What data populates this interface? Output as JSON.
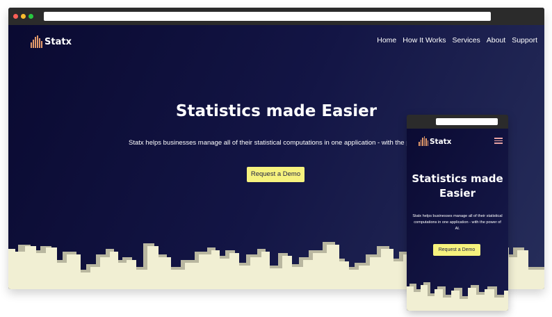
{
  "colors": {
    "accent": "#f6f27e",
    "logo_bars": "#e39a6b",
    "background_dark": "#0a0a31",
    "skyline": "#f1efd3",
    "skyline_shadow": "#b9b7a0"
  },
  "desktop": {
    "brand": "Statx",
    "nav": [
      "Home",
      "How It Works",
      "Services",
      "About",
      "Support"
    ],
    "hero_title": "Statistics made Easier",
    "hero_subtitle": "Statx helps businesses manage all of their statistical computations in one application - with the power",
    "cta_label": "Request a Demo"
  },
  "mobile": {
    "brand": "Statx",
    "menu_icon": "hamburger-icon",
    "hero_title": "Statistics made Easier",
    "hero_subtitle": "Statx helps businesses manage all of their statistical computations in one application - with the power of AI.",
    "cta_label": "Request a Demo"
  }
}
